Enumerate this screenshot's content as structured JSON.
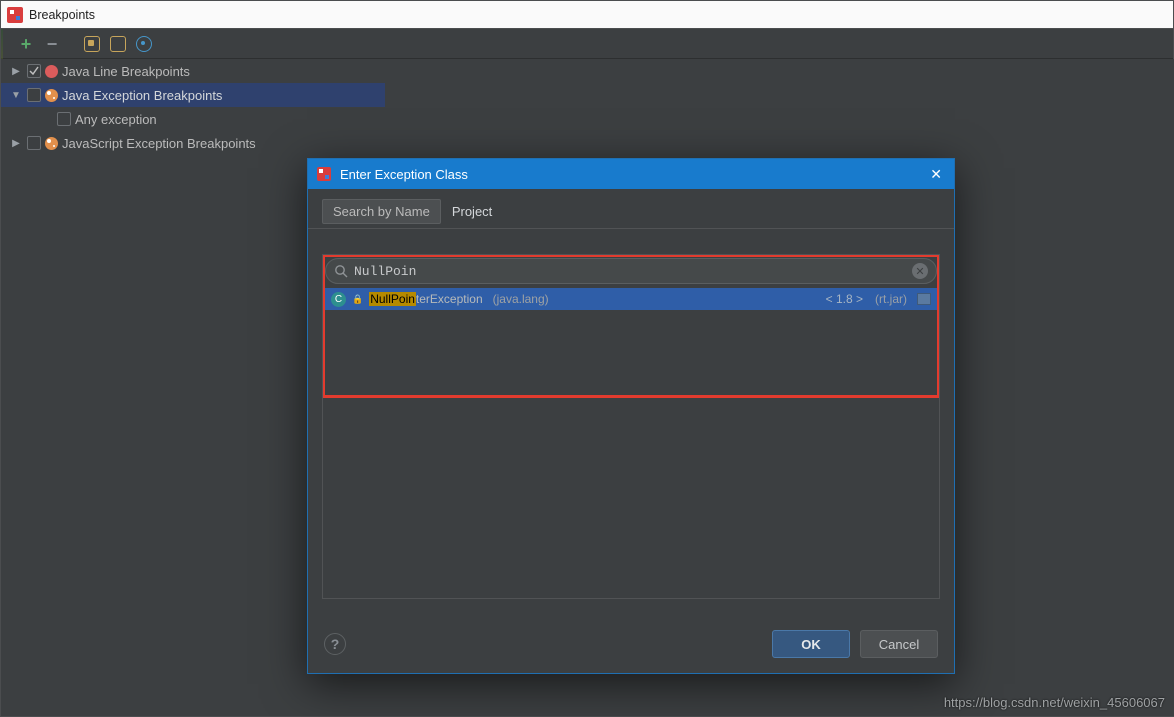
{
  "window": {
    "title": "Breakpoints"
  },
  "toolbar": {
    "add": "+",
    "remove": "−"
  },
  "tree": {
    "items": [
      {
        "expand": "▶",
        "checked": true,
        "dot": "red",
        "label": "Java Line Breakpoints",
        "indent": 0
      },
      {
        "expand": "▼",
        "checked": false,
        "dot": "orange",
        "label": "Java Exception Breakpoints",
        "indent": 0,
        "selected": true
      },
      {
        "expand": "",
        "checked": false,
        "dot": "",
        "label": "Any exception",
        "indent": 2
      },
      {
        "expand": "▶",
        "checked": false,
        "dot": "orange",
        "label": "JavaScript Exception Breakpoints",
        "indent": 0
      }
    ]
  },
  "dialog": {
    "title": "Enter Exception Class",
    "tabs": {
      "byName": "Search by Name",
      "project": "Project"
    },
    "search": {
      "value": "NullPoin"
    },
    "result": {
      "match": "NullPoin",
      "rest": "terException",
      "pkg": "(java.lang)",
      "jdk": "< 1.8 >",
      "lib": "(rt.jar)"
    },
    "buttons": {
      "ok": "OK",
      "cancel": "Cancel"
    },
    "help": "?"
  },
  "watermark": "https://blog.csdn.net/weixin_45606067"
}
